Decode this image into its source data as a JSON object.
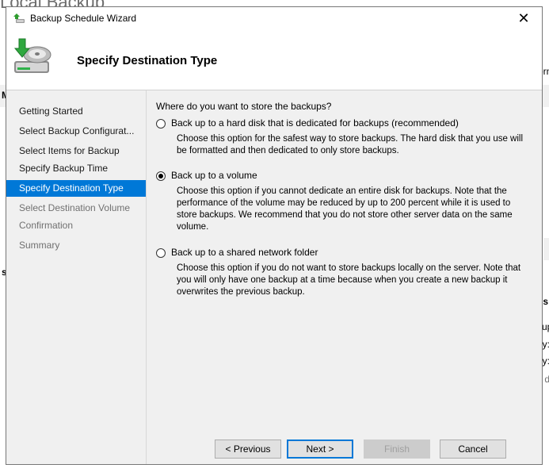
{
  "background": {
    "app_title": "Local Backup",
    "fragments": [
      "orn",
      "ps",
      "kup",
      "py:",
      "py:",
      "v d",
      "M",
      "s"
    ]
  },
  "dialog": {
    "title": "Backup Schedule Wizard",
    "close_glyph": "✕",
    "header_title": "Specify Destination Type"
  },
  "steps": [
    {
      "label": "Getting Started",
      "state": "normal"
    },
    {
      "label": "Select Backup Configurat...",
      "state": "normal"
    },
    {
      "label": "Select Items for Backup",
      "state": "normal"
    },
    {
      "label": "Specify Backup Time",
      "state": "normal"
    },
    {
      "label": "Specify Destination Type",
      "state": "active"
    },
    {
      "label": "Select Destination Volume",
      "state": "dim"
    },
    {
      "label": "Confirmation",
      "state": "dim"
    },
    {
      "label": "Summary",
      "state": "dim"
    }
  ],
  "content": {
    "question": "Where do you want to store the backups?",
    "options": [
      {
        "label": "Back up to a hard disk that is dedicated for backups (recommended)",
        "checked": false,
        "description": "Choose this option for the safest way to store backups. The hard disk that you use will be formatted and then dedicated to only store backups."
      },
      {
        "label": "Back up to a volume",
        "checked": true,
        "description": "Choose this option if you cannot dedicate an entire disk for backups. Note that the performance of the volume may be reduced by up to 200 percent while it is used to store backups. We recommend that you do not store other server data on the same volume."
      },
      {
        "label": "Back up to a shared network folder",
        "checked": false,
        "description": "Choose this option if you do not want to store backups locally on the server. Note that you will only have one backup at a time because when you create a new backup it overwrites the previous backup."
      }
    ]
  },
  "buttons": {
    "previous": "< Previous",
    "next": "Next >",
    "finish": "Finish",
    "cancel": "Cancel"
  },
  "colors": {
    "accent": "#0078d7",
    "panel": "#f0f0f0"
  }
}
